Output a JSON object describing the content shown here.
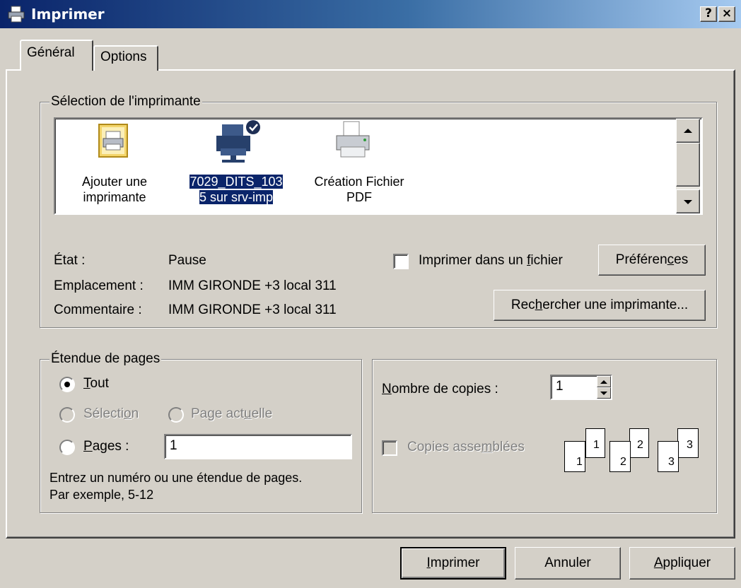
{
  "window": {
    "title": "Imprimer",
    "help_button": "?",
    "close_button": "×"
  },
  "tabs": [
    {
      "label": "Général"
    },
    {
      "label": "Options"
    }
  ],
  "printer_selection": {
    "legend": "Sélection de l'imprimante",
    "printers": [
      {
        "label_line1": "Ajouter une",
        "label_line2": "imprimante",
        "icon": "add-printer-icon",
        "selected": false
      },
      {
        "label_line1": "7029_DITS_103",
        "label_line2": "5 sur srv-imp",
        "icon": "network-printer-icon",
        "selected": true
      },
      {
        "label_line1": "Création Fichier",
        "label_line2": "PDF",
        "icon": "printer-icon",
        "selected": false
      }
    ],
    "status_label": "État :",
    "status_value": "Pause",
    "location_label": "Emplacement :",
    "location_value": "IMM GIRONDE +3 local 311",
    "comment_label": "Commentaire :",
    "comment_value": "IMM GIRONDE +3 local 311",
    "print_to_file_label_pre": "Imprimer dans un ",
    "print_to_file_label_u": "f",
    "print_to_file_label_post": "ichier",
    "print_to_file_checked": false,
    "preferences_pre": "Préféren",
    "preferences_u": "c",
    "preferences_post": "es",
    "find_printer_pre": "Rec",
    "find_printer_u": "h",
    "find_printer_post": "ercher une imprimante..."
  },
  "page_range": {
    "legend": "Étendue de pages",
    "all_u": "T",
    "all_post": "out",
    "all_selected": true,
    "selection_pre": "Sélecti",
    "selection_u": "o",
    "selection_post": "n",
    "current_pre": "Page act",
    "current_u": "u",
    "current_post": "elle",
    "pages_u": "P",
    "pages_post": "ages :",
    "pages_value": "1",
    "help_line1": "Entrez un numéro ou une étendue de pages.",
    "help_line2": "Par exemple, 5-12"
  },
  "copies": {
    "count_u": "N",
    "count_post": "ombre de copies :",
    "count_value": "1",
    "collate_pre": "Copies asse",
    "collate_u": "m",
    "collate_post": "blées",
    "collate_checked": false,
    "collate_sheets": [
      "1",
      "1",
      "2",
      "2",
      "3",
      "3"
    ]
  },
  "buttons": {
    "print_u": "I",
    "print_post": "mprimer",
    "cancel": "Annuler",
    "apply_u": "A",
    "apply_post": "ppliquer"
  }
}
